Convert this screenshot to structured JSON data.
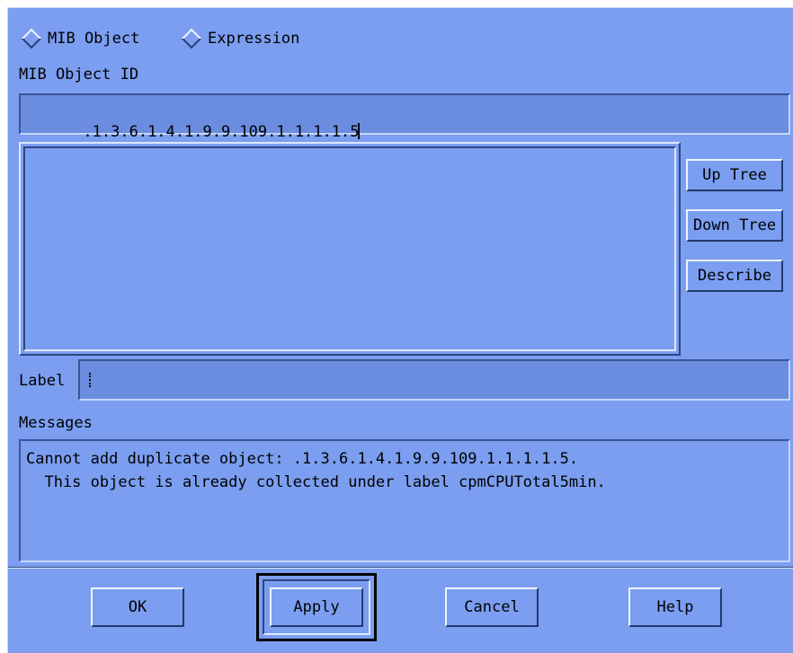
{
  "radio": {
    "mib_object_label": "MIB Object",
    "expression_label": "Expression"
  },
  "mib_object_id": {
    "label": "MIB Object ID",
    "value": ".1.3.6.1.4.1.9.9.109.1.1.1.1.5"
  },
  "tree_buttons": {
    "up_tree": "Up Tree",
    "down_tree": "Down Tree",
    "describe": "Describe"
  },
  "label_field": {
    "label": "Label",
    "value": ""
  },
  "messages": {
    "label": "Messages",
    "lines": [
      "Cannot add duplicate object: .1.3.6.1.4.1.9.9.109.1.1.1.1.5.",
      "  This object is already collected under label cpmCPUTotal5min."
    ]
  },
  "footer": {
    "ok": "OK",
    "apply": "Apply",
    "cancel": "Cancel",
    "help": "Help"
  },
  "colors": {
    "panel": "#7b9ef0",
    "field": "#6a8ddf"
  }
}
